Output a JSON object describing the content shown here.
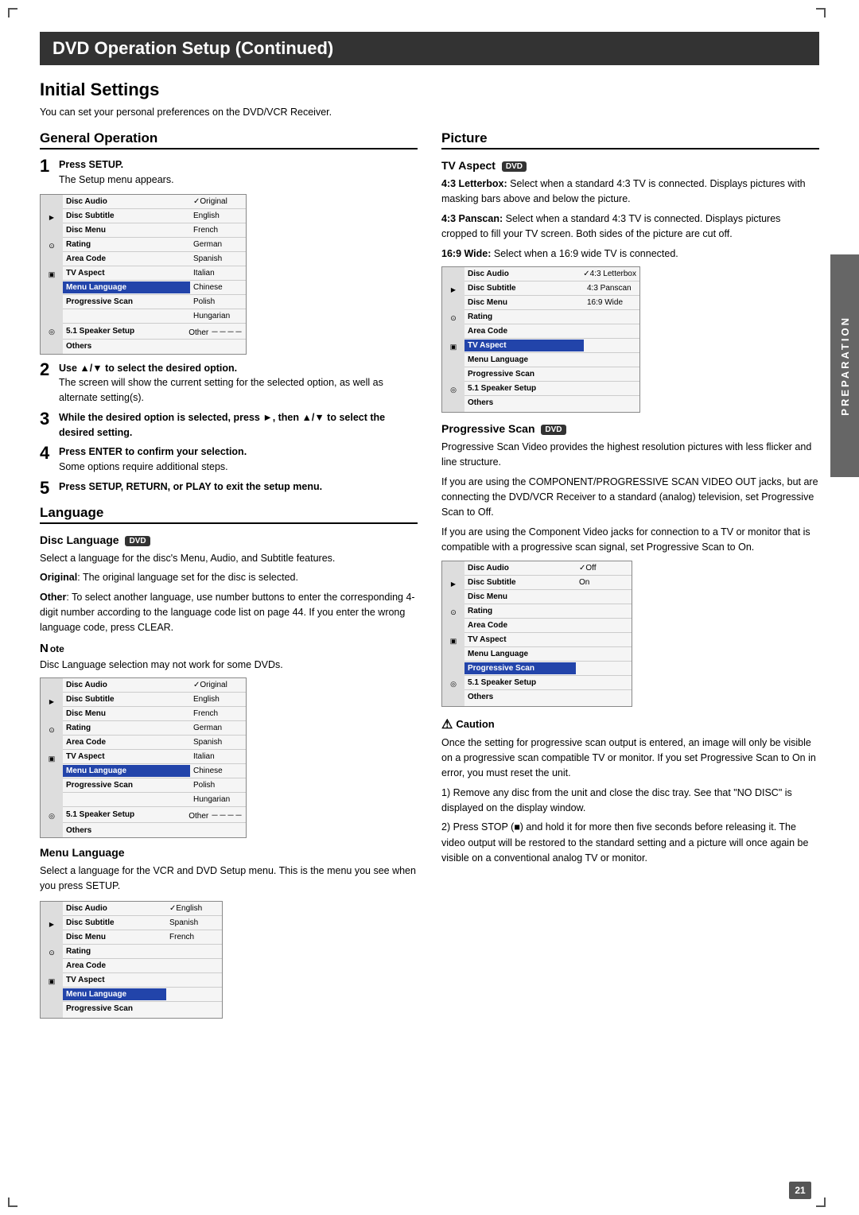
{
  "header": {
    "title": "DVD Operation Setup  (Continued)"
  },
  "page": {
    "main_title": "Initial Settings",
    "intro": "You can set your personal preferences on the DVD/VCR Receiver.",
    "page_number": "21"
  },
  "side_tab": {
    "label": "PREPARATION"
  },
  "general_operation": {
    "title": "General Operation",
    "steps": [
      {
        "num": "1",
        "bold": "Press SETUP.",
        "text": "The Setup menu appears."
      },
      {
        "num": "2",
        "bold": "Use ▲/▼ to select the desired option.",
        "text": "The screen will show the current setting for the selected option, as well as alternate setting(s)."
      },
      {
        "num": "3",
        "bold": "While the desired option is selected, press ►, then ▲/▼ to select the desired setting.",
        "text": ""
      },
      {
        "num": "4",
        "bold": "Press ENTER to confirm your selection.",
        "text": "Some options require additional steps."
      },
      {
        "num": "5",
        "bold": "Press SETUP, RETURN, or PLAY to exit the setup menu.",
        "text": ""
      }
    ]
  },
  "language": {
    "title": "Language",
    "disc_language": {
      "subtitle": "Disc Language",
      "badge": "DVD",
      "body1": "Select a language for the disc's Menu, Audio, and Subtitle features.",
      "original_label": "Original",
      "original_text": ": The original language set for the disc is selected.",
      "other_label": "Other",
      "other_text": ": To select another language, use number buttons to enter the corresponding 4-digit number according to the language code list on page 44. If you enter the wrong language code, press CLEAR."
    },
    "note": {
      "text": "Disc Language selection may not work for some DVDs."
    },
    "menu_language": {
      "subtitle": "Menu Language",
      "body": "Select a language for the VCR and DVD Setup menu. This is the menu you see when you press SETUP."
    }
  },
  "picture": {
    "title": "Picture",
    "tv_aspect": {
      "subtitle": "TV Aspect",
      "badge": "DVD",
      "letterbox_label": "4:3 Letterbox:",
      "letterbox_text": "Select when a standard 4:3 TV is connected. Displays pictures with masking bars above and below the picture.",
      "panscan_label": "4:3 Panscan:",
      "panscan_text": "Select when a standard 4:3 TV is connected. Displays pictures cropped to fill your TV screen. Both sides of the picture are cut off.",
      "wide_label": "16:9 Wide:",
      "wide_text": "Select when a 16:9 wide TV is connected."
    },
    "progressive_scan": {
      "subtitle": "Progressive Scan",
      "badge": "DVD",
      "body1": "Progressive Scan Video provides the highest resolution pictures with less flicker and line structure.",
      "body2": "If you are using the COMPONENT/PROGRESSIVE SCAN VIDEO OUT jacks, but are connecting the DVD/VCR Receiver to a standard (analog) television, set Progressive Scan to Off.",
      "body3": "If you are using the Component Video jacks for connection to a TV or monitor that is compatible with a progressive scan signal, set Progressive Scan to On."
    },
    "caution": {
      "title": "Caution",
      "body1": "Once the setting for progressive scan output is entered, an image will only be visible on a progressive scan compatible TV or monitor. If you set Progressive Scan to On in error, you must reset the unit.",
      "step1": "1) Remove any disc from the unit and close the disc tray. See that \"NO DISC\" is displayed on the display window.",
      "step2": "2) Press STOP (■) and hold it for more then five seconds before releasing it. The video output will be restored to the standard setting and a picture will once again be visible on a conventional analog TV or monitor."
    }
  },
  "menus": {
    "main_menu1": {
      "rows": [
        {
          "label": "Disc Audio",
          "value": "✓Original",
          "selected": false
        },
        {
          "label": "Disc Subtitle",
          "value": "English",
          "selected": false
        },
        {
          "label": "Disc Menu",
          "value": "French",
          "selected": false
        },
        {
          "label": "Rating",
          "value": "German",
          "selected": false
        },
        {
          "label": "Area Code",
          "value": "Spanish",
          "selected": false
        },
        {
          "label": "TV Aspect",
          "value": "Italian",
          "selected": false
        },
        {
          "label": "Menu Language",
          "value": "Chinese",
          "selected": true
        },
        {
          "label": "Progressive Scan",
          "value": "Polish",
          "selected": false
        },
        {
          "label": "",
          "value": "Hungarian",
          "selected": false
        },
        {
          "label": "5.1 Speaker Setup",
          "value": "Other －－－－",
          "selected": false
        },
        {
          "label": "Others",
          "value": "",
          "selected": false
        }
      ]
    },
    "tv_aspect_menu": {
      "rows": [
        {
          "label": "Disc Audio",
          "value": "✓4:3 Letterbox",
          "selected": false
        },
        {
          "label": "Disc Subtitle",
          "value": "4:3 Panscan",
          "selected": false
        },
        {
          "label": "Disc Menu",
          "value": "16:9 Wide",
          "selected": false
        },
        {
          "label": "Rating",
          "value": "",
          "selected": false
        },
        {
          "label": "Area Code",
          "value": "",
          "selected": false
        },
        {
          "label": "TV Aspect",
          "value": "",
          "selected": true
        },
        {
          "label": "Menu Language",
          "value": "",
          "selected": false
        },
        {
          "label": "Progressive Scan",
          "value": "",
          "selected": false
        },
        {
          "label": "5.1 Speaker Setup",
          "value": "",
          "selected": false
        },
        {
          "label": "Others",
          "value": "",
          "selected": false
        }
      ]
    },
    "prog_scan_menu": {
      "rows": [
        {
          "label": "Disc Audio",
          "value": "✓Off",
          "selected": false
        },
        {
          "label": "Disc Subtitle",
          "value": "On",
          "selected": false
        },
        {
          "label": "Disc Menu",
          "value": "",
          "selected": false
        },
        {
          "label": "Rating",
          "value": "",
          "selected": false
        },
        {
          "label": "Area Code",
          "value": "",
          "selected": false
        },
        {
          "label": "TV Aspect",
          "value": "",
          "selected": false
        },
        {
          "label": "Menu Language",
          "value": "",
          "selected": false
        },
        {
          "label": "Progressive Scan",
          "value": "",
          "selected": true
        },
        {
          "label": "5.1 Speaker Setup",
          "value": "",
          "selected": false
        },
        {
          "label": "Others",
          "value": "",
          "selected": false
        }
      ]
    },
    "menu_lang_menu": {
      "rows": [
        {
          "label": "Disc Audio",
          "value": "✓English",
          "selected": false
        },
        {
          "label": "Disc Subtitle",
          "value": "Spanish",
          "selected": false
        },
        {
          "label": "Disc Menu",
          "value": "French",
          "selected": false
        },
        {
          "label": "Rating",
          "value": "",
          "selected": false
        },
        {
          "label": "Area Code",
          "value": "",
          "selected": false
        },
        {
          "label": "TV Aspect",
          "value": "",
          "selected": false
        },
        {
          "label": "Menu Language",
          "value": "",
          "selected": true
        },
        {
          "label": "Progressive Scan",
          "value": "",
          "selected": false
        }
      ]
    }
  }
}
